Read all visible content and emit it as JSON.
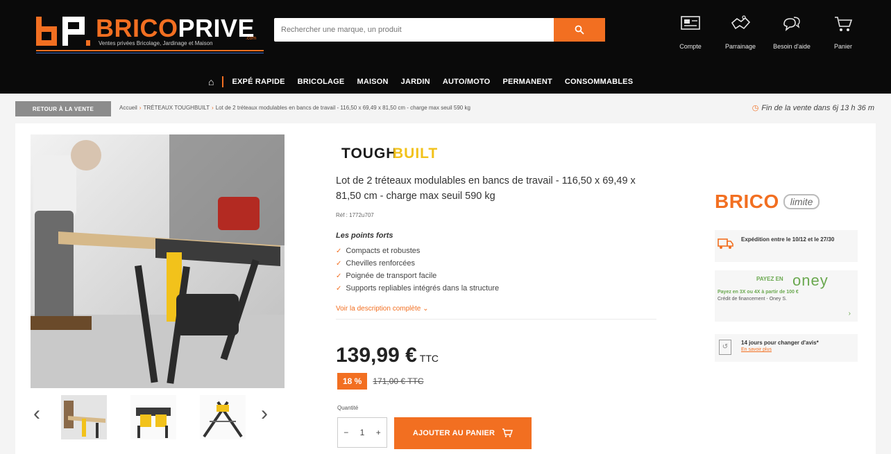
{
  "header": {
    "logo_text_orange": "BRICO",
    "logo_text_white": "PRIVE",
    "logo_domain": ".com",
    "logo_tagline": "Ventes privées Bricolage, Jardinage et Maison",
    "search_placeholder": "Rechercher une marque, un produit",
    "icons": [
      {
        "name": "compte",
        "label": "Compte",
        "icon": "account-card-icon"
      },
      {
        "name": "parrainage",
        "label": "Parrainage",
        "icon": "handshake-icon"
      },
      {
        "name": "aide",
        "label": "Besoin d'aide",
        "icon": "chat-bubbles-icon"
      },
      {
        "name": "panier",
        "label": "Panier",
        "icon": "cart-icon"
      }
    ]
  },
  "nav": {
    "items": [
      "EXPÉ RAPIDE",
      "BRICOLAGE",
      "MAISON",
      "JARDIN",
      "AUTO/MOTO",
      "PERMANENT",
      "CONSOMMABLES"
    ]
  },
  "breadcrumb": {
    "back_label": "RETOUR À LA VENTE",
    "items": [
      "Accueil",
      "TRÉTEAUX TOUGHBUILT",
      "Lot de 2 tréteaux modulables en bancs de travail - 116,50 x 69,49 x 81,50 cm - charge max seuil 590 kg"
    ],
    "sale_end": "Fin de la vente dans 6j 13 h 36 m"
  },
  "product": {
    "brand": "TOUGHBUILT",
    "title": "Lot de 2 tréteaux modulables en bancs de travail - 116,50 x 69,49 x 81,50 cm - charge max seuil 590 kg",
    "ref": "Réf : 1772u707",
    "points_title": "Les points forts",
    "points": [
      "Compacts et robustes",
      "Chevilles renforcées",
      "Poignée de transport facile",
      "Supports repliables intégrés dans la structure"
    ],
    "desc_link": "Voir la description complète",
    "price": "139,99 €",
    "price_suffix": "TTC",
    "discount": "18 %",
    "old_price": "171,00 € TTC",
    "qty_label": "Quantité",
    "qty_value": "1",
    "add_to_cart": "AJOUTER AU PANIER"
  },
  "sidebar": {
    "brico": "BRICO",
    "limite": "limite",
    "shipping": "Expédition entre le 10/12 et le 27/30",
    "oney_pay": "PAYEZ EN",
    "oney_logo": "oney",
    "oney_line1": "Payez en 3X ou 4X à partir de 100 €",
    "oney_line2": "Crédit de financement - Oney S.",
    "returns": "14 jours pour changer d'avis*",
    "returns_link": "En savoir plus"
  },
  "colors": {
    "accent": "#f26f21",
    "header_bg": "#0a0a0a",
    "oney_green": "#6aa84f"
  }
}
